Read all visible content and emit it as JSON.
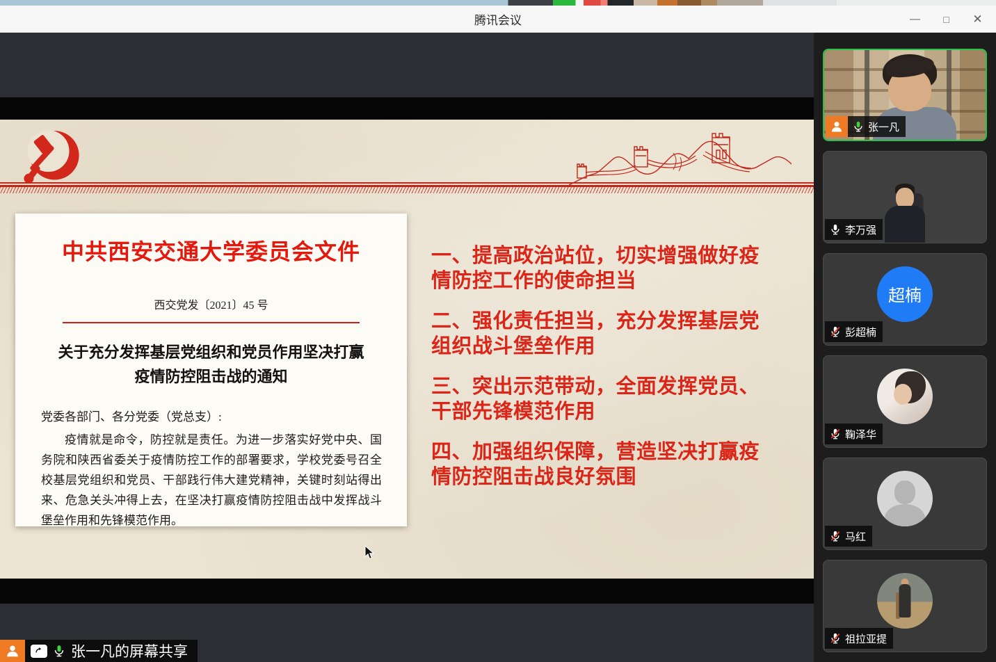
{
  "window": {
    "title": "腾讯会议",
    "controls": {
      "minimize": "—",
      "maximize": "□",
      "close": "✕"
    }
  },
  "slide": {
    "document": {
      "header": "中共西安交通大学委员会文件",
      "number": "西交党发〔2021〕45 号",
      "title_line1": "关于充分发挥基层党组织和党员作用坚决打赢",
      "title_line2": "疫情防控阻击战的通知",
      "salutation": "党委各部门、各分党委（党总支）:",
      "body": "疫情就是命令，防控就是责任。为进一步落实好党中央、国务院和陕西省委关于疫情防控工作的部署要求，学校党委号召全校基层党组织和党员、干部践行伟大建党精神，关键时刻站得出来、危急关头冲得上去，在坚决打赢疫情防控阻击战中发挥战斗堡垒作用和先锋模范作用。"
    },
    "points": [
      "一、提高政治站位，切实增强做好疫情防控工作的使命担当",
      "二、强化责任担当，充分发挥基层党组织战斗堡垒作用",
      "三、突出示范带动，全面发挥党员、干部先锋模范作用",
      "四、加强组织保障，营造坚决打赢疫情防控阻击战良好氛围"
    ]
  },
  "share_banner": {
    "label": "张一凡的屏幕共享"
  },
  "participants": [
    {
      "name": "张一凡",
      "muted": false,
      "speaking": true,
      "host": true,
      "avatar_type": "video-landscape"
    },
    {
      "name": "李万强",
      "muted": false,
      "speaking": false,
      "host": false,
      "avatar_type": "video-portrait"
    },
    {
      "name": "彭超楠",
      "muted": true,
      "speaking": false,
      "host": false,
      "avatar_type": "initials",
      "avatar_text": "超楠",
      "avatar_color": "#1f7cf6"
    },
    {
      "name": "鞠泽华",
      "muted": true,
      "speaking": false,
      "host": false,
      "avatar_type": "photo"
    },
    {
      "name": "马红",
      "muted": true,
      "speaking": false,
      "host": false,
      "avatar_type": "silhouette"
    },
    {
      "name": "祖拉亚提",
      "muted": true,
      "speaking": false,
      "host": false,
      "avatar_type": "photo"
    }
  ],
  "colors": {
    "speaking_border": "#27c24a",
    "host_badge": "#ee7a23",
    "avatar_blue": "#1f7cf6",
    "slide_red": "#c2271b",
    "doc_header_red": "#e4190e",
    "point_red": "#da2518",
    "mic_on_green": "#3ed33e",
    "mute_slash_red": "#e0392b"
  }
}
